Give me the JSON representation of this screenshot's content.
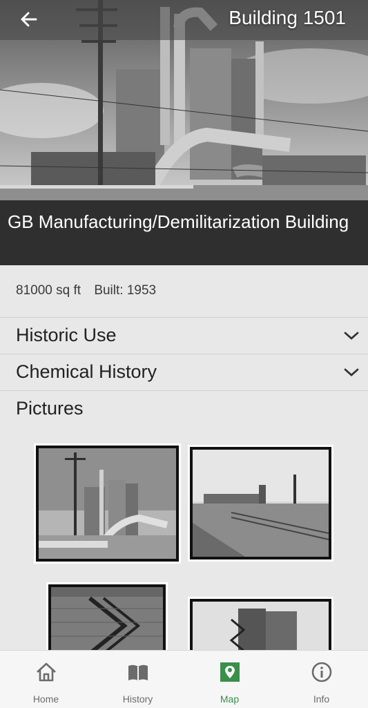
{
  "header": {
    "back_icon": "arrow-left-icon",
    "building_label": "Building 1501"
  },
  "building": {
    "name": "GB Manufacturing/Demilitarization Building",
    "area": "81000 sq ft",
    "built": "Built: 1953"
  },
  "sections": [
    {
      "label": "Historic Use",
      "icon": "chevron-down-icon"
    },
    {
      "label": "Chemical History",
      "icon": "chevron-down-icon"
    },
    {
      "label": "Pictures"
    }
  ],
  "bottom_nav": {
    "items": [
      {
        "label": "Home",
        "icon": "home-icon",
        "active": false
      },
      {
        "label": "History",
        "icon": "book-icon",
        "active": false
      },
      {
        "label": "Map",
        "icon": "map-marker-icon",
        "active": true
      },
      {
        "label": "Info",
        "icon": "info-icon",
        "active": false
      }
    ]
  },
  "colors": {
    "active": "#3a8f4a",
    "inactive": "#6b6b6b",
    "title_band": "#2f2f2f"
  }
}
